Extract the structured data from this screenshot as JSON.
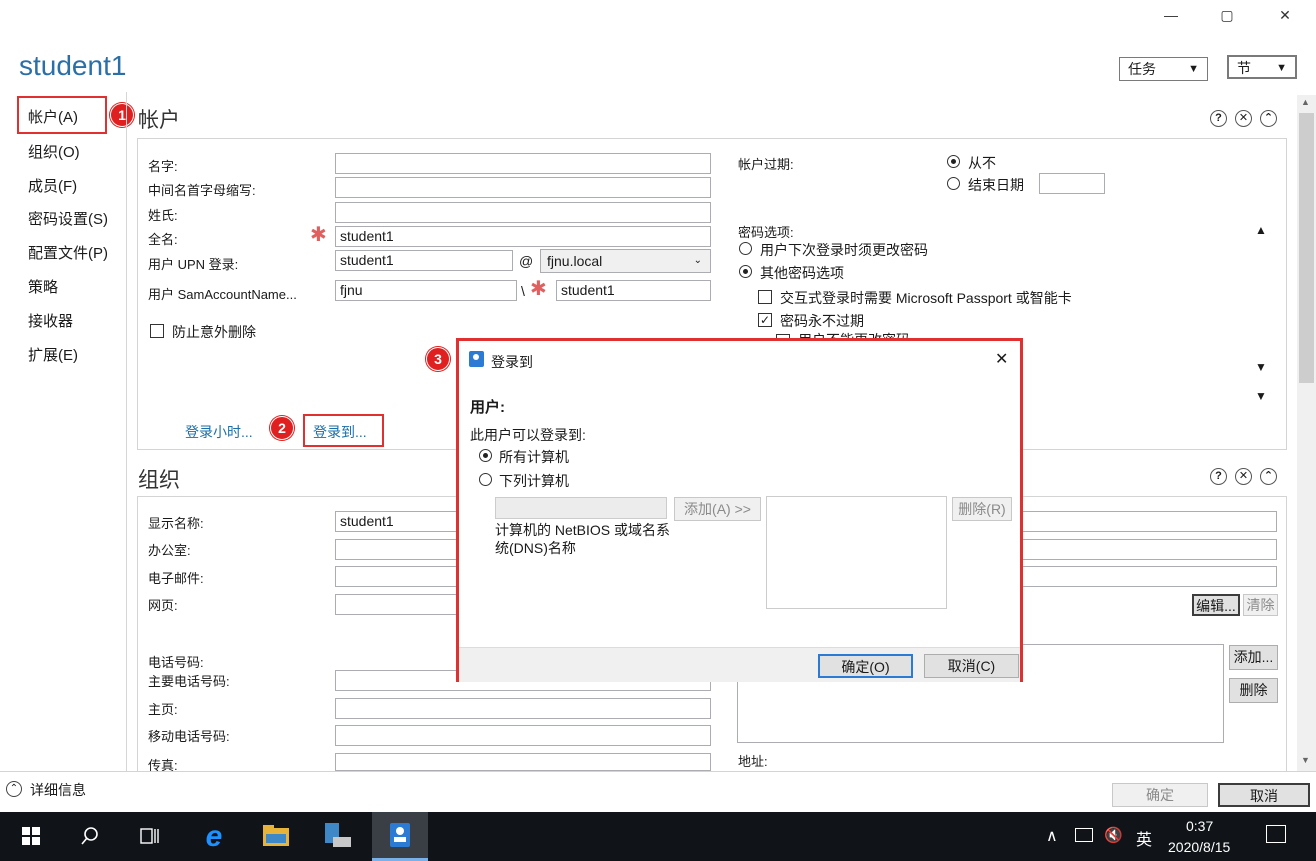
{
  "window": {
    "title": "student1",
    "minimize": "—",
    "maximize": "▢",
    "close": "✕"
  },
  "toolbar": {
    "tasks_label": "任务",
    "sections_label": "节",
    "dropdown_arrow": "▼"
  },
  "nav": {
    "items": [
      {
        "label": "帐户(A)"
      },
      {
        "label": "组织(O)"
      },
      {
        "label": "成员(F)"
      },
      {
        "label": "密码设置(S)"
      },
      {
        "label": "配置文件(P)"
      },
      {
        "label": "策略"
      },
      {
        "label": "接收器"
      },
      {
        "label": "扩展(E)"
      }
    ]
  },
  "account": {
    "section_title": "帐户",
    "help": "?",
    "close": "✕",
    "collapse": "⌃",
    "first_name_label": "名字:",
    "first_name_value": "",
    "middle_initial_label": "中间名首字母缩写:",
    "middle_initial_value": "",
    "last_name_label": "姓氏:",
    "last_name_value": "",
    "full_name_label": "全名:",
    "full_name_value": "student1",
    "upn_label": "用户 UPN 登录:",
    "upn_value": "student1",
    "at": "@",
    "domain_value": "fjnu.local",
    "sam_label": "用户 SamAccountName...",
    "sam_domain": "fjnu",
    "backslash": "\\",
    "sam_value": "student1",
    "protect_label": "防止意外删除",
    "logon_hours_link": "登录小时...",
    "logon_to_link": "登录到...",
    "expires_label": "帐户过期:",
    "never_label": "从不",
    "end_date_label": "结束日期",
    "end_date_value": "",
    "pwd_options_label": "密码选项:",
    "must_change_label": "用户下次登录时须更改密码",
    "other_options_label": "其他密码选项",
    "smartcard_label": "交互式登录时需要 Microsoft Passport 或智能卡",
    "never_expires_label": "密码永不过期",
    "cannot_change_label": "用户不能更改密码",
    "check": "✓",
    "scroll_up": "▲",
    "scroll_down": "▼"
  },
  "org": {
    "section_title": "组织",
    "display_name_label": "显示名称:",
    "display_name_value": "student1",
    "office_label": "办公室:",
    "email_label": "电子邮件:",
    "web_label": "网页:",
    "phone_label": "电话号码:",
    "main_phone_label": "主要电话号码:",
    "home_label": "主页:",
    "mobile_label": "移动电话号码:",
    "fax_label": "传真:",
    "address_label": "地址:",
    "edit_button": "编辑...",
    "clear_button": "清除",
    "add_button": "添加...",
    "remove_button": "删除"
  },
  "dialog": {
    "title": "登录到",
    "user_label": "用户:",
    "can_logon_label": "此用户可以登录到:",
    "all_computers": "所有计算机",
    "following_computers": "下列计算机",
    "computer_input": "",
    "add_button": "添加(A) >>",
    "remove_button": "删除(R)",
    "hint": "计算机的 NetBIOS 或域名系统(DNS)名称",
    "ok_button": "确定(O)",
    "cancel_button": "取消(C)"
  },
  "badges": [
    "1",
    "2",
    "3"
  ],
  "footer": {
    "details_label": "详细信息",
    "ok_button": "确定",
    "cancel_button": "取消"
  },
  "taskbar": {
    "time": "0:37",
    "date": "2020/8/15",
    "ime": "英",
    "chevron": "∧"
  }
}
